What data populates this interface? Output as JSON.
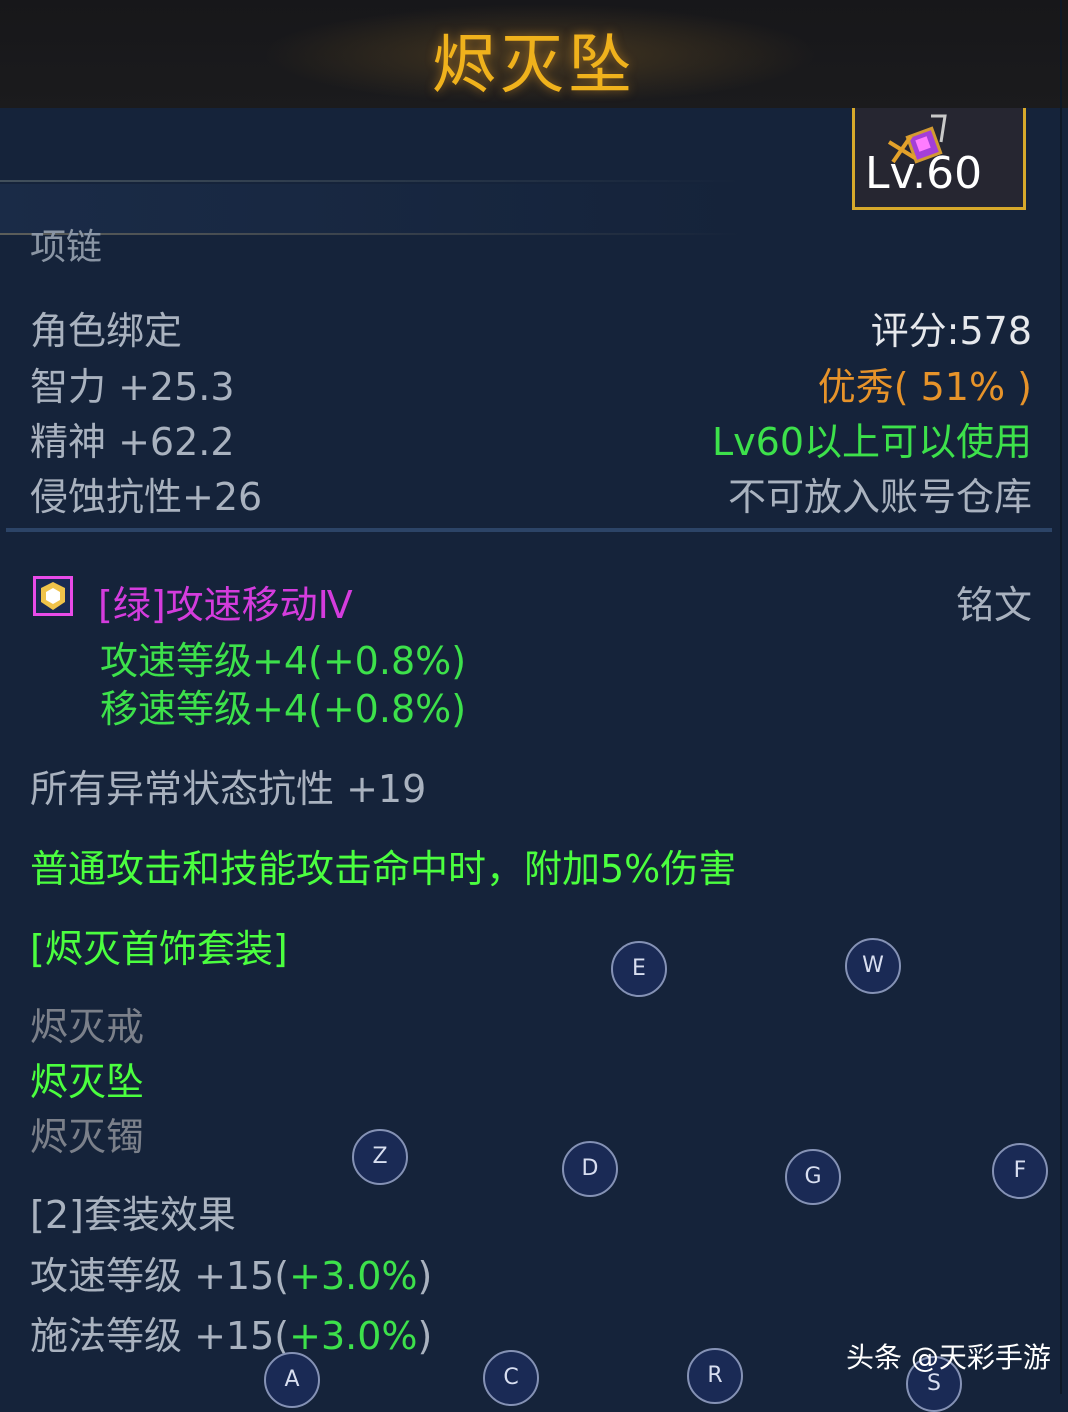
{
  "window": {
    "title": "烬灭坠"
  },
  "item": {
    "level_label": "Lv.60",
    "icon": "pendant-item-icon",
    "slot": "项链"
  },
  "stats_left": [
    "角色绑定",
    "智力 +25.3",
    "精神 +62.2",
    "侵蚀抗性+26"
  ],
  "stats_right": {
    "score": "评分:578",
    "quality": "优秀( 51% )",
    "level_requirement": "Lv60以上可以使用",
    "storage": "不可放入账号仓库"
  },
  "rune": {
    "icon": "rune-icon",
    "name": "[绿]攻速移动Ⅳ",
    "tag": "铭文",
    "bonus_1": "攻速等级+4(+0.8%)",
    "bonus_2": "移速等级+4(+0.8%)"
  },
  "extra_stat": "所有异常状态抗性 +19",
  "special_effect": "普通攻击和技能攻击命中时，附加5%伤害",
  "set": {
    "name": "[烬灭首饰套装]",
    "pieces": [
      "烬灭戒",
      "烬灭坠",
      "烬灭镯"
    ],
    "bonus_title": "[2]套装效果",
    "bonus_1_label": "攻速等级 +15(",
    "bonus_1_value": "+3.0%",
    "bonus_2_label": "施法等级 +15(",
    "bonus_2_value": "+3.0%",
    "close_paren": ")"
  },
  "overlay_keys": [
    "E",
    "W",
    "Z",
    "D",
    "G",
    "F",
    "A",
    "C",
    "R",
    "S"
  ],
  "watermark": "头条 @天彩手游",
  "colors": {
    "title": "#f0b21c",
    "green": "#3de14b",
    "orange": "#e6932a",
    "magenta": "#d43cdd",
    "frame": "#d7a92b",
    "background": "#15233a"
  }
}
